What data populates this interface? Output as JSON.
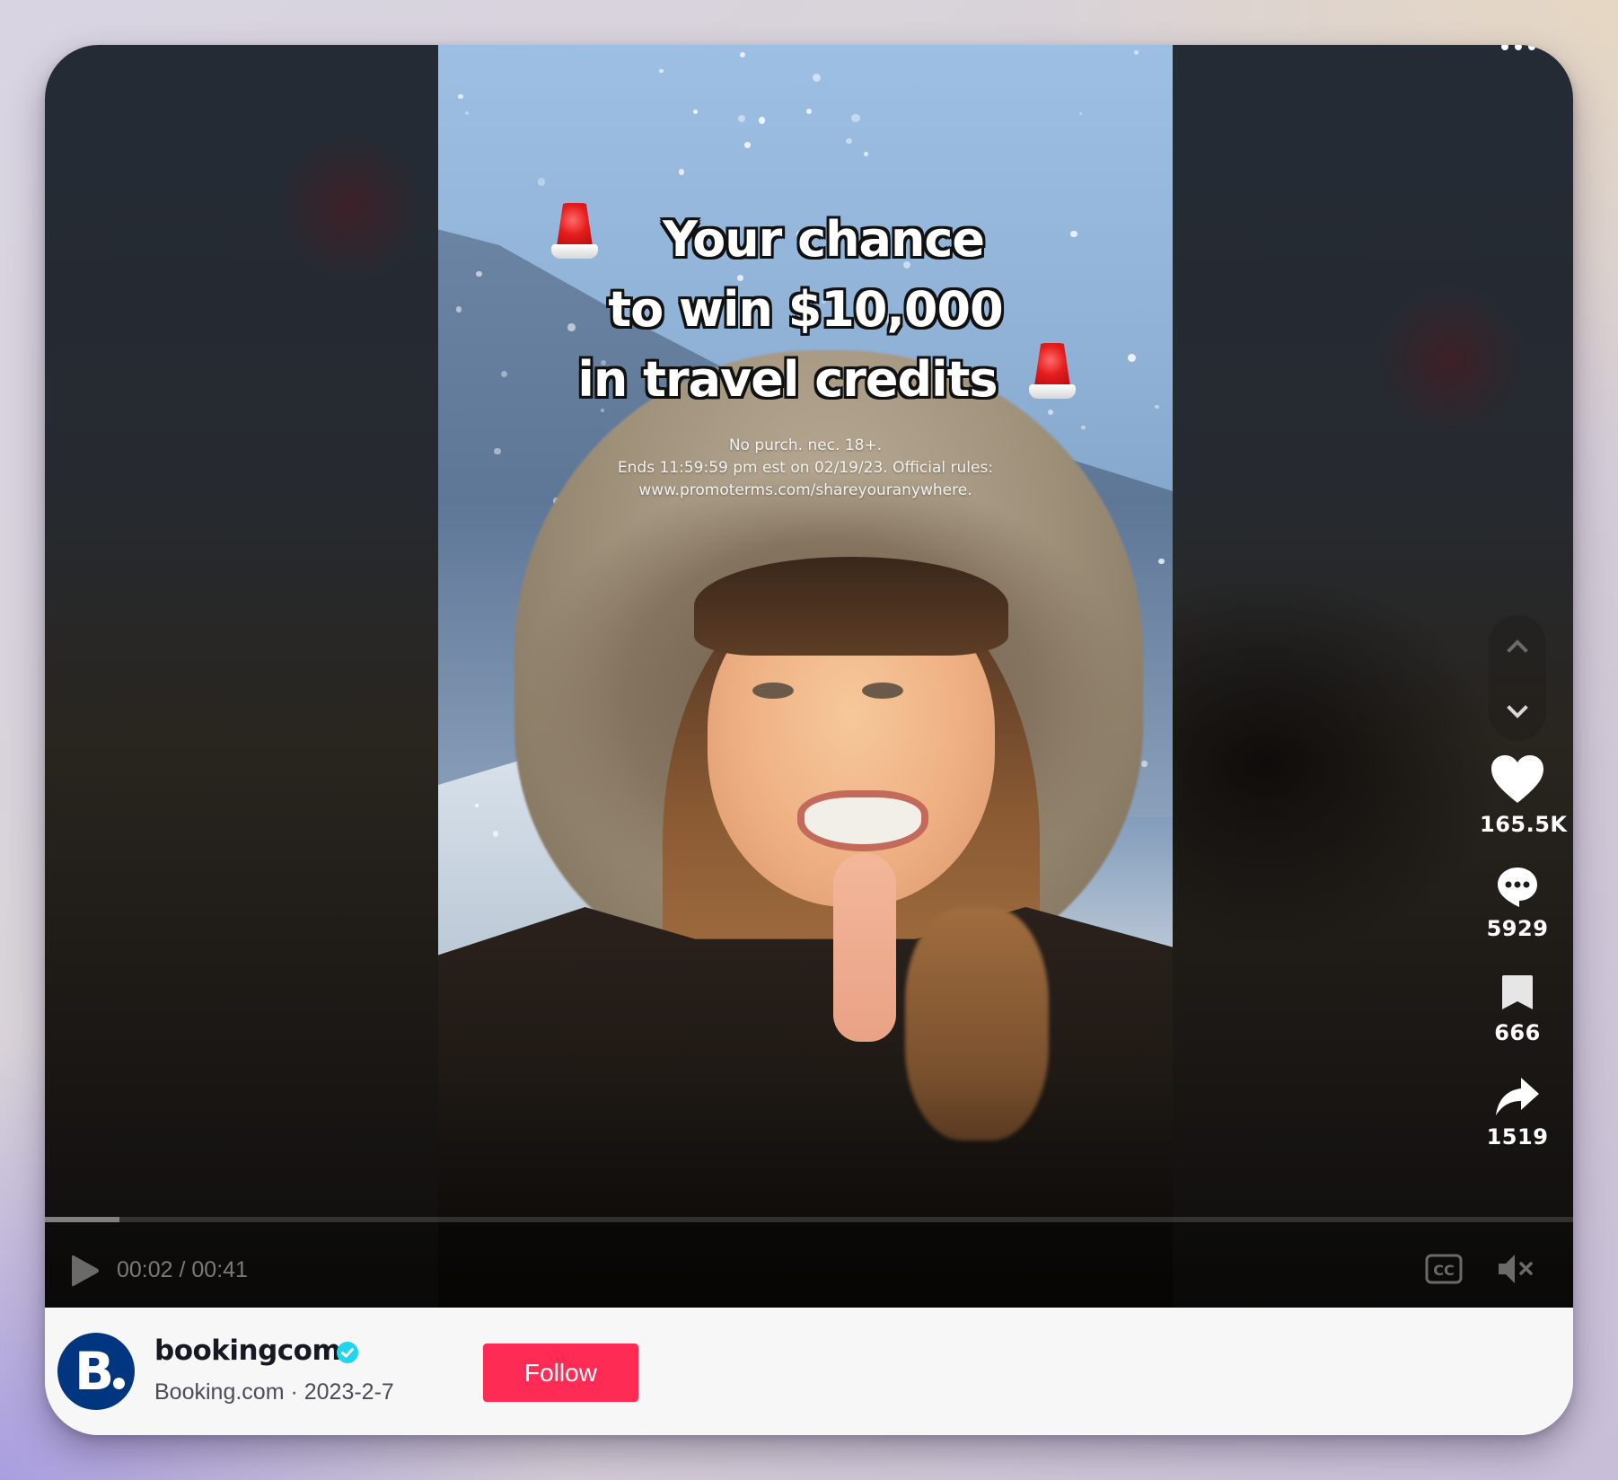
{
  "video": {
    "overlay_headline": [
      "Your chance",
      "to win $10,000",
      "in travel credits"
    ],
    "overlay_icons": [
      "police-siren-icon",
      "police-siren-icon"
    ],
    "fine_print": [
      "No purch. nec. 18+.",
      "Ends 11:59:59 pm est on 02/19/23. Official rules:",
      "www.promoterms.com/shareyouranywhere."
    ],
    "scene": "woman in fur-hooded coat against snowy mountain backdrop"
  },
  "player": {
    "current_time": "00:02",
    "duration": "00:41",
    "time_display": "00:02 / 00:41",
    "progress_fraction": 0.049,
    "state": "paused",
    "muted": true,
    "controls": {
      "play": "play-icon",
      "captions": "cc-icon",
      "mute": "volume-muted-icon",
      "more": "more-icon"
    }
  },
  "navigation": {
    "previous": "chevron-up-icon",
    "next": "chevron-down-icon"
  },
  "actions": [
    {
      "id": "like",
      "icon": "heart-icon",
      "count": "165.5K"
    },
    {
      "id": "comment",
      "icon": "comment-icon",
      "count": "5929"
    },
    {
      "id": "save",
      "icon": "bookmark-icon",
      "count": "666"
    },
    {
      "id": "share",
      "icon": "share-icon",
      "count": "1519"
    }
  ],
  "author": {
    "username": "bookingcom",
    "verified": true,
    "display_name": "Booking.com",
    "date": "2023-2-7",
    "subline": "Booking.com · 2023-2-7",
    "avatar_letter": "B",
    "follow_label": "Follow"
  },
  "colors": {
    "follow_button": "#fe2c55",
    "avatar_bg": "#003580",
    "verified_badge": "#20d5ec",
    "footer_bg": "#f7f7f7"
  }
}
